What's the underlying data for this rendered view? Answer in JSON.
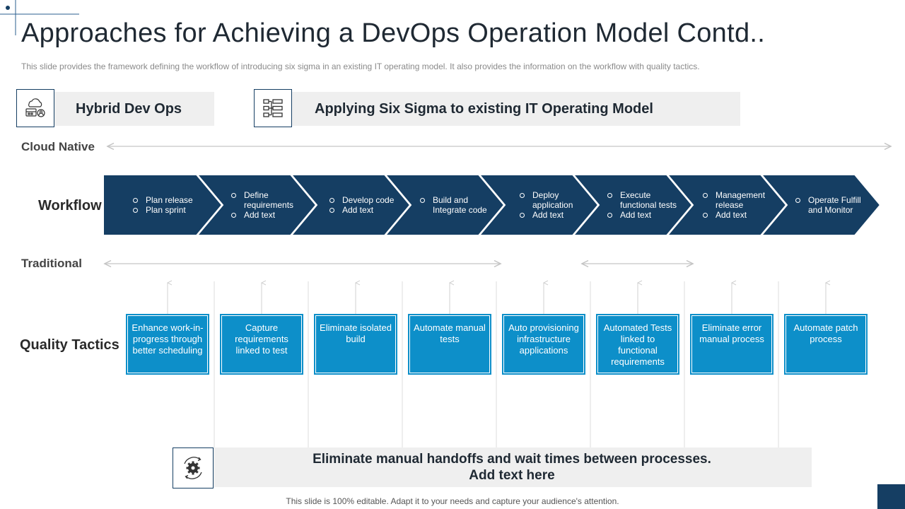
{
  "title": "Approaches for Achieving a DevOps Operation Model Contd..",
  "subtitle": "This slide provides the framework defining the workflow of introducing six sigma in an existing IT operating model. It also provides the information on the workflow with quality tactics.",
  "headers": {
    "left": {
      "label": "Hybrid Dev Ops",
      "icon": "cloud-devices-icon"
    },
    "right": {
      "label": "Applying Six Sigma to existing IT Operating Model",
      "icon": "hierarchy-list-icon"
    }
  },
  "rows": {
    "cloud_native": "Cloud Native",
    "workflow": "Workflow",
    "traditional": "Traditional",
    "quality_tactics": "Quality Tactics"
  },
  "workflow_steps": [
    {
      "lines": [
        {
          "text": "Plan release",
          "bullet": true
        },
        {
          "text": "Plan sprint",
          "bullet": true
        }
      ]
    },
    {
      "lines": [
        {
          "text": "Define",
          "bullet": true
        },
        {
          "text": "requirements",
          "bullet": false
        },
        {
          "text": "Add text",
          "bullet": true
        }
      ]
    },
    {
      "lines": [
        {
          "text": "Develop code",
          "bullet": true
        },
        {
          "text": "Add text",
          "bullet": true
        }
      ]
    },
    {
      "lines": [
        {
          "text": "Build and",
          "bullet": true
        },
        {
          "text": "Integrate code",
          "bullet": false
        }
      ]
    },
    {
      "lines": [
        {
          "text": "Deploy",
          "bullet": true
        },
        {
          "text": "application",
          "bullet": false
        },
        {
          "text": "Add text",
          "bullet": true
        }
      ]
    },
    {
      "lines": [
        {
          "text": "Execute",
          "bullet": true
        },
        {
          "text": "functional tests",
          "bullet": false
        },
        {
          "text": "Add text",
          "bullet": true
        }
      ]
    },
    {
      "lines": [
        {
          "text": "Management",
          "bullet": true
        },
        {
          "text": "release",
          "bullet": false
        },
        {
          "text": "Add text",
          "bullet": true
        }
      ]
    },
    {
      "lines": [
        {
          "text": "Operate Fulfill",
          "bullet": true
        },
        {
          "text": "and Monitor",
          "bullet": false
        }
      ]
    }
  ],
  "quality_tactics": [
    "Enhance work-in-progress through better scheduling",
    "Capture requirements linked to test",
    "Eliminate isolated build",
    "Automate manual tests",
    "Auto provisioning infrastructure applications",
    "Automated Tests linked to functional requirements",
    "Eliminate error manual process",
    "Automate patch process"
  ],
  "bottom": {
    "line1": "Eliminate manual handoffs and wait times between processes.",
    "line2": "Add text here",
    "icon": "gear-cycle-icon"
  },
  "footer": "This slide is 100% editable. Adapt it to your needs and capture your audience's attention.",
  "colors": {
    "navy": "#153e63",
    "blue": "#0d8fc9",
    "gray_bar": "#efefef"
  }
}
